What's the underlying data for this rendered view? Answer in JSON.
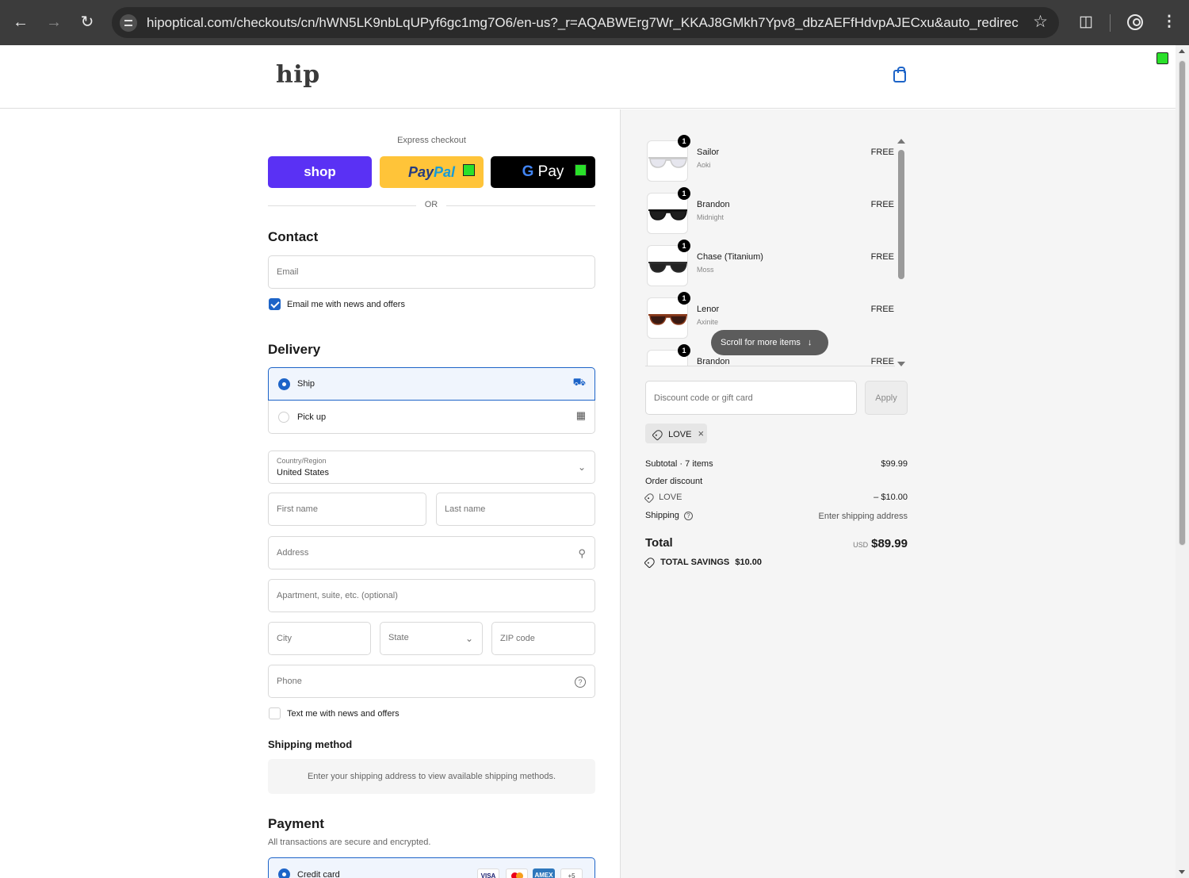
{
  "browser": {
    "url": "hipoptical.com/checkouts/cn/hWN5LK9nbLqUPyf6gc1mg7O6/en-us?_r=AQABWErg7Wr_KKAJ8GMkh7Ypv8_dbzAEFfHdvpAJECxu&auto_redirect=false..."
  },
  "header": {
    "logo": "hip"
  },
  "express": {
    "label": "Express checkout",
    "shop_label": "shop",
    "paypal_part1": "Pay",
    "paypal_part2": "Pal",
    "gpay_g": "G",
    "gpay_label": "Pay",
    "or_label": "OR"
  },
  "contact": {
    "title": "Contact",
    "email_placeholder": "Email",
    "newsletter_label": "Email me with news and offers",
    "newsletter_checked": true
  },
  "delivery": {
    "title": "Delivery",
    "options": [
      {
        "label": "Ship",
        "selected": true
      },
      {
        "label": "Pick up",
        "selected": false
      }
    ],
    "country_label": "Country/Region",
    "country_value": "United States",
    "first_name": "First name",
    "last_name": "Last name",
    "address": "Address",
    "apartment": "Apartment, suite, etc. (optional)",
    "city": "City",
    "state": "State",
    "zip": "ZIP code",
    "phone": "Phone",
    "sms_label": "Text me with news and offers",
    "sms_checked": false
  },
  "shipping_method": {
    "title": "Shipping method",
    "note": "Enter your shipping address to view available shipping methods."
  },
  "payment": {
    "title": "Payment",
    "subtitle": "All transactions are secure and encrypted.",
    "method_label": "Credit card",
    "cards": [
      "VISA",
      "MC",
      "AMEX",
      "+5"
    ]
  },
  "cart": {
    "items": [
      {
        "qty": "1",
        "name": "Sailor",
        "variant": "Aoki",
        "price": "FREE",
        "lens_color": "#e6e6ee",
        "frame_color": "#c9c9c9"
      },
      {
        "qty": "1",
        "name": "Brandon",
        "variant": "Midnight",
        "price": "FREE",
        "lens_color": "#1e1e1e",
        "frame_color": "#111111"
      },
      {
        "qty": "1",
        "name": "Chase (Titanium)",
        "variant": "Moss",
        "price": "FREE",
        "lens_color": "#222222",
        "frame_color": "#2c2c2c"
      },
      {
        "qty": "1",
        "name": "Lenor",
        "variant": "Axinite",
        "price": "FREE",
        "lens_color": "#3a1a12",
        "frame_color": "#8a3b1c"
      },
      {
        "qty": "1",
        "name": "Brandon",
        "variant": "",
        "price": "FREE",
        "lens_color": "#1e1e1e",
        "frame_color": "#111111"
      }
    ],
    "scroll_hint": "Scroll for more items",
    "discount_placeholder": "Discount code or gift card",
    "apply_label": "Apply",
    "applied_code": "LOVE",
    "subtotal_label": "Subtotal · 7 items",
    "subtotal_value": "$99.99",
    "order_discount_label": "Order discount",
    "discount_code": "LOVE",
    "discount_value": "– $10.00",
    "shipping_label": "Shipping",
    "shipping_value": "Enter shipping address",
    "total_label": "Total",
    "currency": "USD",
    "total_value": "$89.99",
    "savings_label": "TOTAL SAVINGS",
    "savings_value": "$10.00"
  },
  "colors": {
    "accent": "#1d64c8",
    "shop": "#5a31f4",
    "paypal": "#ffc439"
  }
}
